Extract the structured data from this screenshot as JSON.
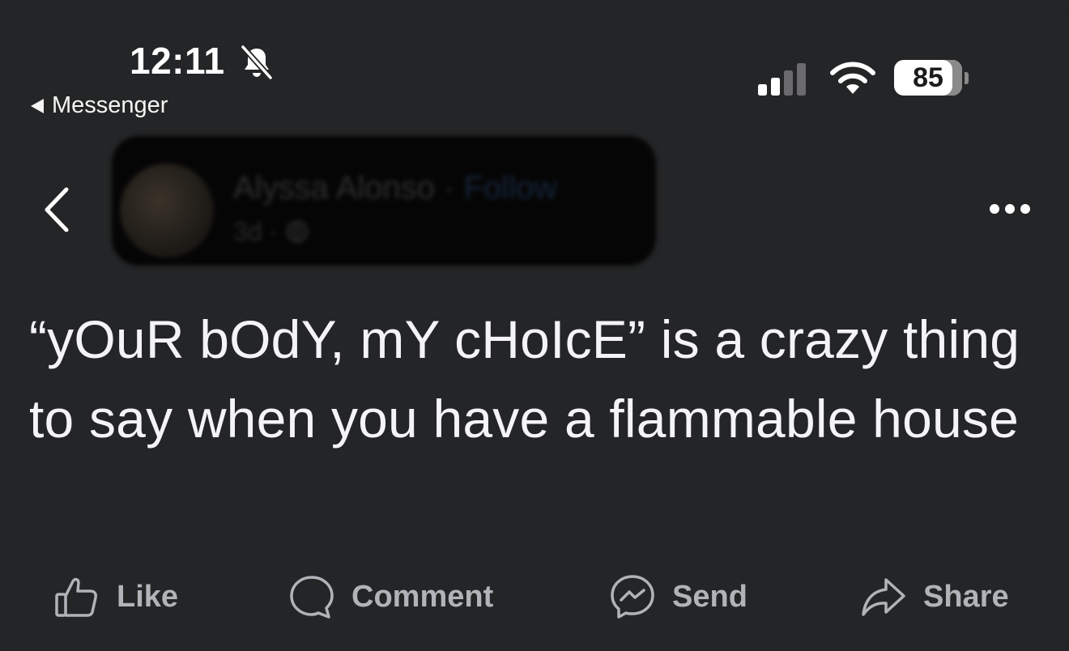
{
  "status_bar": {
    "time": "12:11",
    "back_app_label": "Messenger",
    "battery_level": "85",
    "icons": [
      "bell-slash-icon",
      "cellular-signal-icon",
      "wifi-icon",
      "battery-icon"
    ],
    "signal_bars_active": 2,
    "signal_bars_total": 4
  },
  "post": {
    "author_name": "Alyssa Alonso",
    "separator": "·",
    "follow_label": "Follow",
    "timestamp": "3d",
    "audience_icon": "globe-icon",
    "text": "“yOuR bOdY, mY cHoIcE” is a crazy thing to say when you have a flammable house"
  },
  "actions": [
    {
      "label": "Like",
      "icon": "thumbs-up-icon"
    },
    {
      "label": "Comment",
      "icon": "comment-bubble-icon"
    },
    {
      "label": "Send",
      "icon": "messenger-icon"
    },
    {
      "label": "Share",
      "icon": "share-arrow-icon"
    }
  ],
  "colors": {
    "background": "#242526",
    "text": "#f4f4f6",
    "action_text": "#b0b3b8"
  }
}
